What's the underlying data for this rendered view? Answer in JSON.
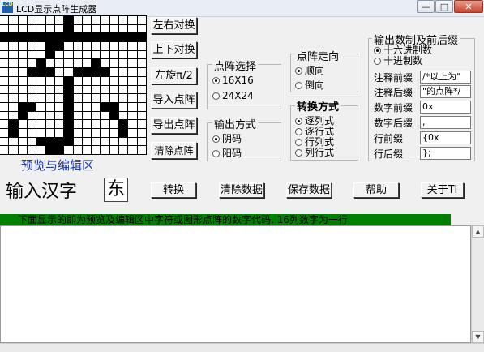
{
  "window": {
    "title": "LCD显示点阵生成器",
    "icon_text": "LCD",
    "min_label": "—",
    "max_label": "□",
    "close_label": "✕"
  },
  "grid": {
    "rows": [
      "0000000100000000",
      "0000000100000000",
      "1111111111111111",
      "0000011000000000",
      "0000010000000000",
      "0000100000100000",
      "0001110011110000",
      "0000000100000000",
      "0000000100000000",
      "0000000100000000",
      "0011000100011000",
      "0010000100001000",
      "0100000100000100",
      "0100000100000100",
      "0000111100000000",
      "0000011000000000"
    ]
  },
  "preview_label": "预览与编辑区",
  "side_buttons": [
    "左右对换",
    "上下对换",
    "左旋π/2",
    "导入点阵",
    "导出点阵",
    "清除点阵"
  ],
  "dot_select": {
    "title": "点阵选择",
    "options": [
      "16X16",
      "24X24"
    ],
    "selected": 0
  },
  "output_mode": {
    "title": "输出方式",
    "options": [
      "阴码",
      "阳码"
    ],
    "selected": 0
  },
  "direction": {
    "title": "点阵走向",
    "options": [
      "顺向",
      "倒向"
    ],
    "selected": 0
  },
  "convert": {
    "title": "转换方式",
    "options": [
      "逐列式",
      "逐行式",
      "行列式",
      "列行式"
    ],
    "selected": 0
  },
  "output_format": {
    "title": "输出数制及前后缀",
    "options": [
      "十六进制数",
      "十进制数"
    ],
    "selected": 0,
    "fields": [
      {
        "label": "注释前缀",
        "value": "/*以上为\""
      },
      {
        "label": "注释后缀",
        "value": "\"的点阵*/"
      },
      {
        "label": "数字前缀",
        "value": "0x"
      },
      {
        "label": "数字后缀",
        "value": ","
      },
      {
        "label": "行前缀",
        "value": "{0x"
      },
      {
        "label": "行后缀",
        "value": "};"
      }
    ]
  },
  "input": {
    "label": "输入汉字",
    "value": "东"
  },
  "bottom_buttons": [
    "转换",
    "清除数据",
    "保存数据",
    "帮助",
    "关于TI"
  ],
  "banner": "下面显示的即为预览及编辑区中字符或图形点阵的数字代码, 16列数字为一行"
}
